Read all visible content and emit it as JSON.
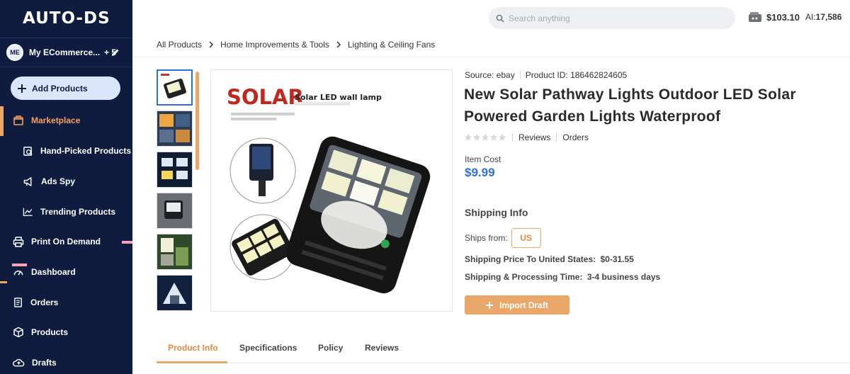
{
  "brand": {
    "logo_text": "AUTO-DS"
  },
  "account": {
    "initials": "ME",
    "name": "My ECommerce...",
    "extra": "+ 5"
  },
  "sidebar": {
    "add_button": "Add Products",
    "items": [
      {
        "label": "Marketplace",
        "icon": "store-icon",
        "active": true
      },
      {
        "label": "Hand-Picked Products",
        "icon": "hand-picked-icon"
      },
      {
        "label": "Ads Spy",
        "icon": "megaphone-icon"
      },
      {
        "label": "Trending Products",
        "icon": "trending-chart-icon"
      },
      {
        "label": "Print On Demand",
        "icon": "print-on-demand-icon"
      },
      {
        "label": "Dashboard",
        "icon": "dashboard-icon"
      },
      {
        "label": "Orders",
        "icon": "orders-icon"
      },
      {
        "label": "Products",
        "icon": "products-box-icon"
      },
      {
        "label": "Drafts",
        "icon": "drafts-cloud-icon"
      }
    ]
  },
  "header": {
    "search_placeholder": "Search anything",
    "balance": "$103.10",
    "ai_label": "AI:",
    "ai_credits": "17,586"
  },
  "breadcrumb": [
    "All Products",
    "Home Improvements & Tools",
    "Lighting & Ceiling Fans"
  ],
  "product": {
    "source": "Source: ebay",
    "product_id": "Product ID: 186462824605",
    "title": "New Solar Pathway Lights Outdoor LED Solar Powered Garden Lights Waterproof",
    "reviews_label": "Reviews",
    "orders_label": "Orders",
    "rating_stars": 0,
    "cost_label": "Item Cost",
    "cost": "$9.99",
    "image_headline": "SOLAR",
    "image_subhead": "Solar LED wall lamp"
  },
  "shipping": {
    "heading": "Shipping Info",
    "ships_from_label": "Ships from:",
    "ships_from_value": "US",
    "price_label": "Shipping Price To United States:",
    "price_value": "$0-31.55",
    "time_label": "Shipping & Processing Time:",
    "time_value": "3-4 business days"
  },
  "actions": {
    "import_draft": "Import Draft"
  },
  "tabs": [
    "Product Info",
    "Specifications",
    "Policy",
    "Reviews"
  ],
  "colors": {
    "sidebar_bg": "#0f1c3f",
    "accent": "#e9a86a",
    "price_blue": "#2f6fd6"
  }
}
